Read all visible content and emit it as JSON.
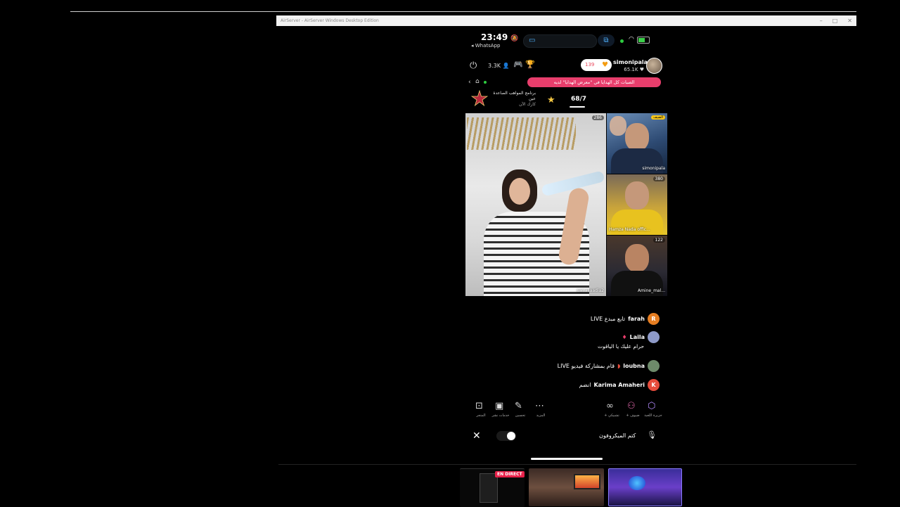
{
  "window": {
    "title": "AirServer - AirServer Windows Desktop Edition"
  },
  "status": {
    "time": "23:49",
    "back_app": "◂ WhatsApp",
    "mute_glyph": "🔕",
    "wifi": "wifi",
    "battery": "charging"
  },
  "live": {
    "viewers": "3.3K",
    "likes": "139",
    "host_name": "simonipala",
    "host_followers": "65.1K",
    "banner": "الصبات كل الهدايا في \"معرض الهدايا\" لديه",
    "program_title": "برنامج المواهب الصاعدة",
    "program_sub": "عين",
    "program_sub2": "كارك الآن",
    "score": "68/7"
  },
  "videos": {
    "main_label": "sarrasaadia2",
    "main_count": "286",
    "side": [
      {
        "label": "simonipala",
        "tag": "الضيف"
      },
      {
        "label": "Hamza Nada offic...",
        "tag": "380"
      },
      {
        "label": "Amine_mal...",
        "tag": "122"
      }
    ]
  },
  "comments": [
    {
      "avatar": "R",
      "avatar_color": "#e67e22",
      "user": "farah",
      "text": "تابع مبدع LIVE"
    },
    {
      "avatar": "",
      "avatar_color": "#8e9ac8",
      "user": "Laila",
      "text": "حرام عليك يا الياقوت"
    },
    {
      "avatar": "",
      "avatar_color": "#6d8a6a",
      "user": "loubna",
      "text": "قام بمشاركة فيديو LIVE"
    },
    {
      "avatar": "K",
      "avatar_color": "#e74c3c",
      "user": "Karima Amaheri",
      "text": "انضم"
    }
  ],
  "action_bar": {
    "left": [
      {
        "icon": "shopping-bag-icon",
        "label": "المتجر"
      },
      {
        "icon": "chat-icon",
        "label": "خدمات نشر"
      },
      {
        "icon": "wand-icon",
        "label": "تحسين"
      },
      {
        "icon": "more-icon",
        "label": "المزيد"
      }
    ],
    "right": [
      {
        "icon": "link-icon",
        "label": "+ تشبيكي"
      },
      {
        "icon": "guests-icon",
        "label": "+ ضيوف"
      },
      {
        "icon": "box-icon",
        "label": "جزيرة اللعبة"
      }
    ]
  },
  "mic": {
    "mute_label": "كتم الميكروفون"
  },
  "thumbnails": [
    {
      "badge": "EN DIRECT"
    },
    {
      "badge": ""
    },
    {
      "badge": ""
    }
  ]
}
